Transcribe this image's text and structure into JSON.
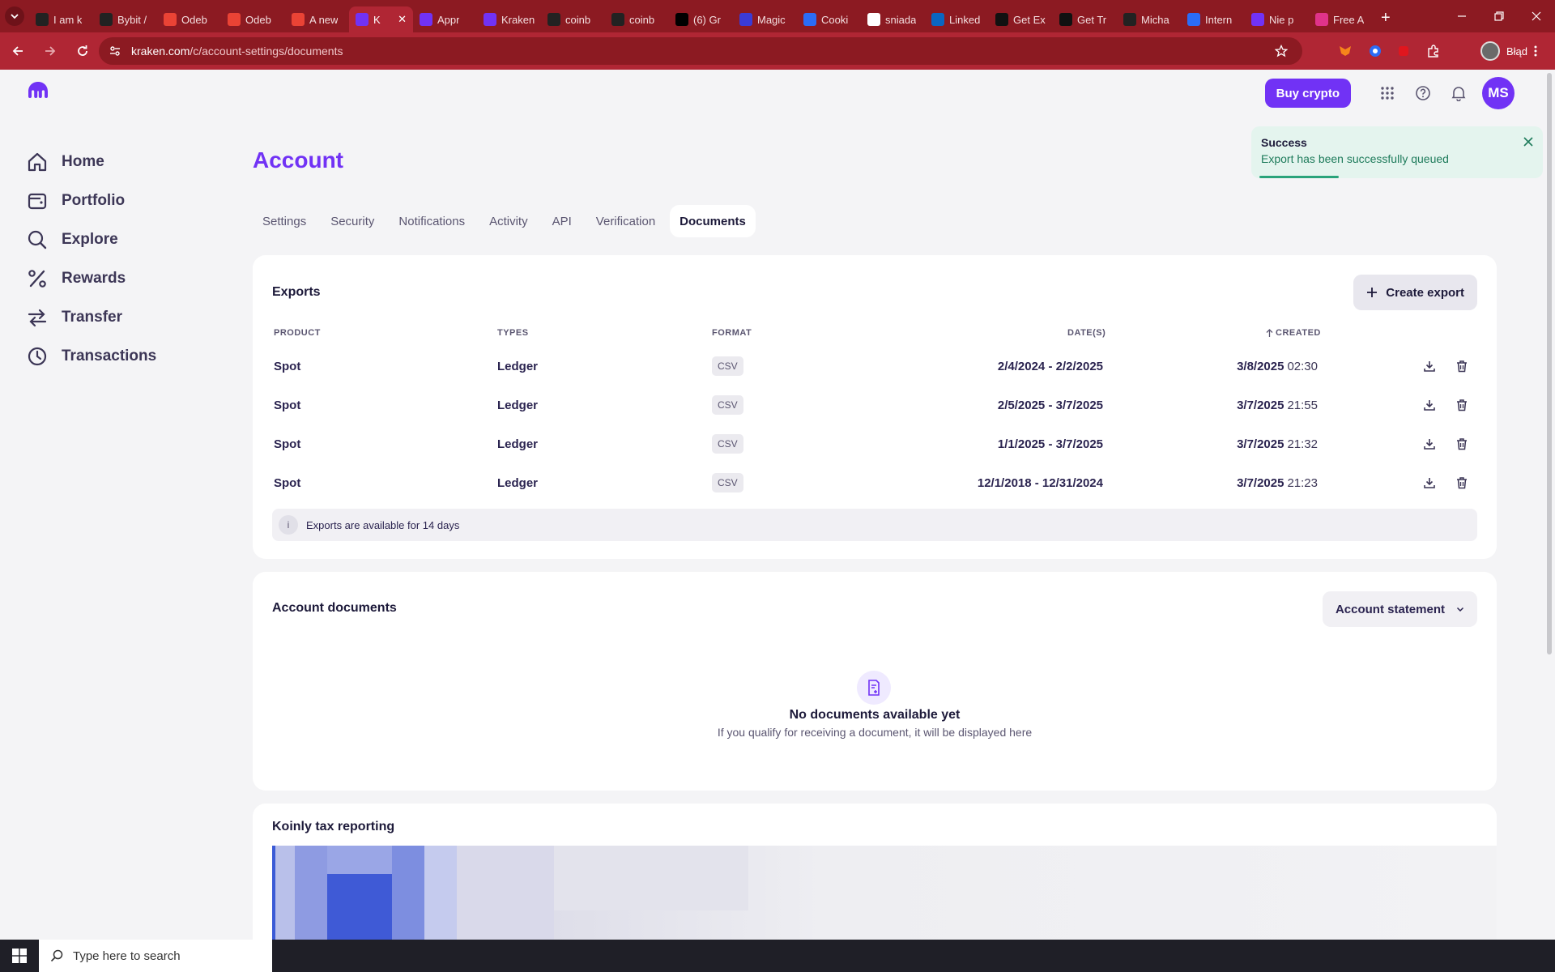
{
  "browser": {
    "tabs": [
      {
        "title": "I am k",
        "icon": "badge-icon",
        "color": "#222222"
      },
      {
        "title": "Bybit /",
        "icon": "openai-icon",
        "color": "#222222"
      },
      {
        "title": "Odeb",
        "icon": "gmail-icon",
        "color": "#ea4335"
      },
      {
        "title": "Odeb",
        "icon": "gmail-icon",
        "color": "#ea4335"
      },
      {
        "title": "A new",
        "icon": "gmail-icon",
        "color": "#ea4335"
      },
      {
        "title": "K",
        "icon": "kraken-icon",
        "color": "#7132f5",
        "active": true
      },
      {
        "title": "Appr",
        "icon": "kraken-icon",
        "color": "#7132f5"
      },
      {
        "title": "Kraken",
        "icon": "kraken-icon",
        "color": "#7132f5"
      },
      {
        "title": "coinb",
        "icon": "github-icon",
        "color": "#222222"
      },
      {
        "title": "coinb",
        "icon": "github-icon",
        "color": "#222222"
      },
      {
        "title": "(6) Gr",
        "icon": "x-icon",
        "color": "#000000"
      },
      {
        "title": "Magic",
        "icon": "magic-icon",
        "color": "#3b3bd6"
      },
      {
        "title": "Cooki",
        "icon": "cookie-icon",
        "color": "#2b6cf6"
      },
      {
        "title": "sniada",
        "icon": "google-icon",
        "color": "#ffffff"
      },
      {
        "title": "Linked",
        "icon": "linkedin-icon",
        "color": "#0a66c2"
      },
      {
        "title": "Get Ex",
        "icon": "bybit-icon",
        "color": "#111111"
      },
      {
        "title": "Get Tr",
        "icon": "bybit-icon",
        "color": "#111111"
      },
      {
        "title": "Micha",
        "icon": "github-icon",
        "color": "#222222"
      },
      {
        "title": "Intern",
        "icon": "cookie-icon",
        "color": "#2b6cf6"
      },
      {
        "title": "Nie p",
        "icon": "kraken-icon",
        "color": "#7132f5"
      },
      {
        "title": "Free A",
        "icon": "flag-icon",
        "color": "#e0338a"
      }
    ],
    "url_host": "kraken.com",
    "url_path": "/c/account-settings/documents",
    "profile_label": "Błąd"
  },
  "header": {
    "buy_label": "Buy crypto",
    "avatar_initials": "MS"
  },
  "sidebar": {
    "items": [
      {
        "label": "Home",
        "icon": "home-icon"
      },
      {
        "label": "Portfolio",
        "icon": "portfolio-icon"
      },
      {
        "label": "Explore",
        "icon": "search-icon"
      },
      {
        "label": "Rewards",
        "icon": "percent-icon"
      },
      {
        "label": "Transfer",
        "icon": "transfer-icon"
      },
      {
        "label": "Transactions",
        "icon": "clock-icon"
      }
    ]
  },
  "toast": {
    "title": "Success",
    "message": "Export has been successfully queued"
  },
  "page": {
    "title": "Account",
    "tabs": [
      "Settings",
      "Security",
      "Notifications",
      "Activity",
      "API",
      "Verification",
      "Documents"
    ],
    "active_tab": "Documents"
  },
  "exports": {
    "title": "Exports",
    "create_label": "Create export",
    "columns": [
      "PRODUCT",
      "TYPES",
      "FORMAT",
      "DATE(S)",
      "CREATED"
    ],
    "rows": [
      {
        "product": "Spot",
        "type": "Ledger",
        "format": "CSV",
        "dates": "2/4/2024 - 2/2/2025",
        "created_date": "3/8/2025",
        "created_time": "02:30"
      },
      {
        "product": "Spot",
        "type": "Ledger",
        "format": "CSV",
        "dates": "2/5/2025 - 3/7/2025",
        "created_date": "3/7/2025",
        "created_time": "21:55"
      },
      {
        "product": "Spot",
        "type": "Ledger",
        "format": "CSV",
        "dates": "1/1/2025 - 3/7/2025",
        "created_date": "3/7/2025",
        "created_time": "21:32"
      },
      {
        "product": "Spot",
        "type": "Ledger",
        "format": "CSV",
        "dates": "12/1/2018 - 12/31/2024",
        "created_date": "3/7/2025",
        "created_time": "21:23"
      }
    ],
    "info": "Exports are available for 14 days"
  },
  "account_documents": {
    "title": "Account documents",
    "select_value": "Account statement",
    "empty_title": "No documents available yet",
    "empty_sub": "If you qualify for receiving a document, it will be displayed here"
  },
  "koinly": {
    "title": "Koinly tax reporting"
  },
  "taskbar": {
    "search_placeholder": "Type here to search"
  },
  "colors": {
    "brand": "#7132f5",
    "browser_frame": "#b02634",
    "success_bg": "#e4f4ee"
  }
}
